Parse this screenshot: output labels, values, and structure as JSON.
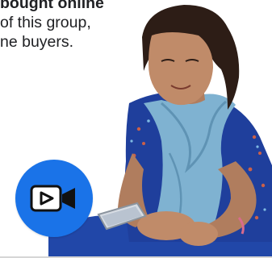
{
  "intro": {
    "lines": [
      "bought online",
      "of this group,",
      "ne buyers."
    ]
  },
  "photo": {
    "icon": "person-with-phone-photo"
  },
  "video_badge": {
    "icon": "video-camera-icon",
    "color": "#1a73e8"
  }
}
